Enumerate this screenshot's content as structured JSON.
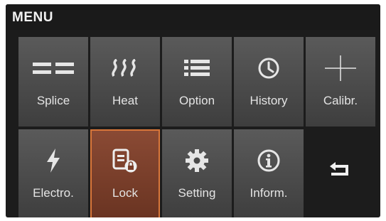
{
  "header": {
    "title": "MENU"
  },
  "row1": [
    {
      "label": "Splice",
      "icon": "splice-icon"
    },
    {
      "label": "Heat",
      "icon": "heat-icon"
    },
    {
      "label": "Option",
      "icon": "list-icon"
    },
    {
      "label": "History",
      "icon": "clock-icon"
    },
    {
      "label": "Calibr.",
      "icon": "crosshair-icon"
    }
  ],
  "row2": [
    {
      "label": "Electro.",
      "icon": "lightning-icon"
    },
    {
      "label": "Lock",
      "icon": "lock-document-icon",
      "selected": true
    },
    {
      "label": "Setting",
      "icon": "gear-icon"
    },
    {
      "label": "Inform.",
      "icon": "info-icon"
    }
  ],
  "back": {
    "icon": "return-arrow-icon"
  },
  "colors": {
    "selected_border": "#d9773a",
    "selected_fill": "#7a3e2a",
    "tile": "#4a4a4a",
    "background": "#1c1c1c"
  }
}
